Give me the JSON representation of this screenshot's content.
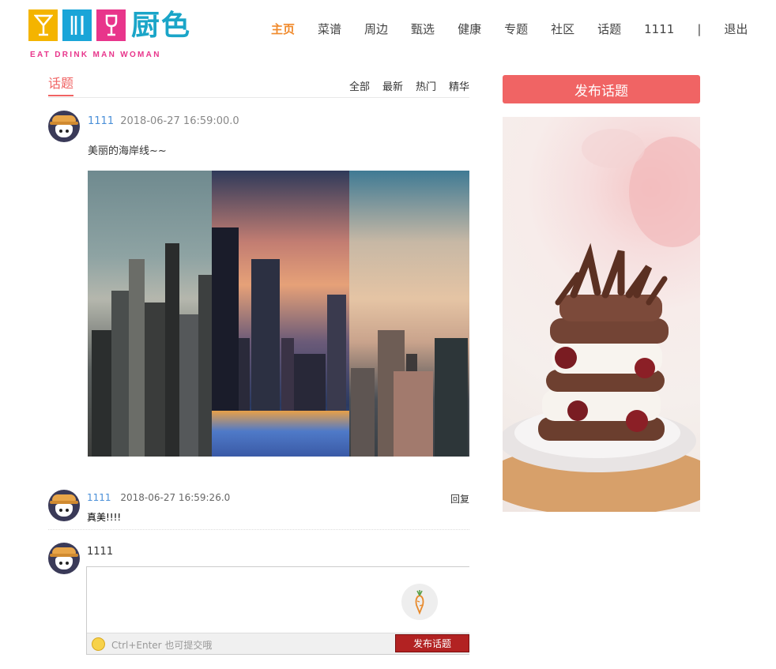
{
  "header": {
    "logo_text": "厨色",
    "logo_subtext": "EAT DRINK MAN WOMAN",
    "nav": [
      "主页",
      "菜谱",
      "周边",
      "甄选",
      "健康",
      "专题",
      "社区",
      "话题",
      "1111"
    ],
    "active_nav": "主页",
    "separator": "|",
    "logout": "退出"
  },
  "topics": {
    "title": "话题",
    "filters": [
      "全部",
      "最新",
      "热门",
      "精华"
    ]
  },
  "post": {
    "user": "1111",
    "timestamp": "2018-06-27 16:59:00.0",
    "text": "美丽的海岸线~~",
    "image_icon": "city-skyline-collage-image"
  },
  "reply": {
    "user": "1111",
    "timestamp": "2018-06-27 16:59:26.0",
    "text": "真美!!!!",
    "reply_label": "回复"
  },
  "composer": {
    "user": "1111",
    "input_value": "",
    "hint": "Ctrl+Enter 也可提交哦",
    "submit_label": "发布话题",
    "emoji_icon": "smiley-icon",
    "mascot_icon": "carrot-icon"
  },
  "sidebar": {
    "publish_label": "发布话题",
    "ad_image": "chocolate-cake-image"
  },
  "colors": {
    "accent": "#f06464",
    "nav_active": "#f08a2c",
    "user_link": "#4a8fd8",
    "submit": "#b22222"
  }
}
